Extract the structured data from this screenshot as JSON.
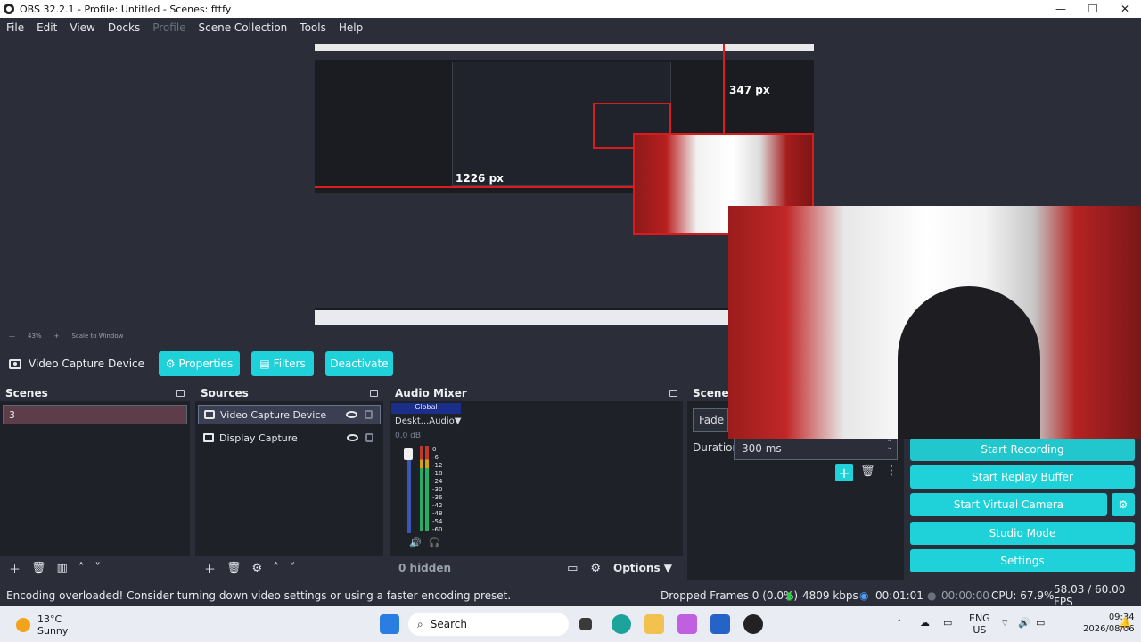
{
  "window": {
    "title": "OBS 32.2.1 - Profile: Untitled - Scenes: fttfy",
    "minimize": "—",
    "maximize": "❐",
    "close": "✕"
  },
  "menu": [
    "File",
    "Edit",
    "View",
    "Docks",
    "Profile",
    "Scene Collection",
    "Tools",
    "Help"
  ],
  "preview": {
    "measure_top": "347 px",
    "measure_left": "1226 px",
    "zoom": "43%",
    "scale": "Scale to Window"
  },
  "source_toolbar": {
    "name": "Video Capture Device",
    "properties": "Properties",
    "filters": "Filters",
    "deactivate": "Deactivate"
  },
  "scenes": {
    "title": "Scenes",
    "items": [
      "3"
    ]
  },
  "sources": {
    "title": "Sources",
    "items": [
      {
        "name": "Video Capture Device",
        "icon": "camera-icon"
      },
      {
        "name": "Display Capture",
        "icon": "monitor-icon"
      }
    ]
  },
  "audio_mixer": {
    "title": "Audio Mixer",
    "global": "Global",
    "device": "Deskt...Audio",
    "db": "0.0 dB",
    "scale": [
      "0",
      "-6",
      "-12",
      "-18",
      "-24",
      "-30",
      "-36",
      "-42",
      "-48",
      "-54",
      "-60"
    ],
    "hidden": "0 hidden",
    "options": "Options"
  },
  "transitions": {
    "title": "Scene T",
    "type": "Fade",
    "duration_label": "Duration",
    "duration_value": "300 ms"
  },
  "controls": {
    "start_recording": "Start Recording",
    "replay_buffer": "Start Replay Buffer",
    "virtual_camera": "Start Virtual Camera",
    "studio_mode": "Studio Mode",
    "settings": "Settings"
  },
  "status": {
    "message": "Encoding overloaded! Consider turning down video settings or using a faster encoding preset.",
    "dropped": "Dropped Frames 0 (0.0%)",
    "kbps": "4809 kbps",
    "stream_time": "00:01:01",
    "record_time": "00:00:00",
    "cpu": "CPU: 67.9%",
    "fps": "58.03 / 60.00 FPS"
  },
  "taskbar": {
    "temp": "13°C",
    "weather": "Sunny",
    "search": "Search",
    "lang1": "ENG",
    "lang2": "US",
    "time": "09:34",
    "date": "2026/08/06"
  },
  "colors": {
    "accent": "#1fd1d8",
    "panel": "#1f2128",
    "background": "#2b2e38",
    "scene_selected": "#5d3d4a"
  }
}
